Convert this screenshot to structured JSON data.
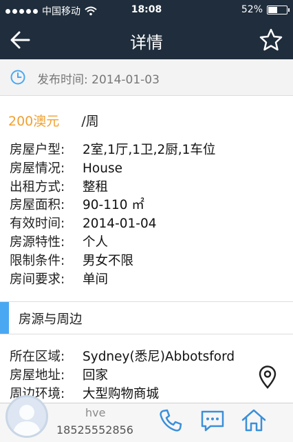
{
  "status_bar": {
    "carrier": "中国移动",
    "time": "18:08",
    "battery": "52%",
    "battery_level": 0.52
  },
  "nav": {
    "title": "详情",
    "back_icon": "back-arrow-icon",
    "favorite_icon": "star-icon"
  },
  "publish": {
    "text": "发布时间:  2014-01-03",
    "icon": "clock-icon"
  },
  "price": {
    "amount": "200澳元",
    "unit": "/周"
  },
  "attributes": [
    {
      "label": "房屋户型:",
      "value": "2室,1厅,1卫,2厨,1车位"
    },
    {
      "label": "房屋情况:",
      "value": "House"
    },
    {
      "label": "出租方式:",
      "value": "整租"
    },
    {
      "label": "房屋面积:",
      "value": "90-110 ㎡"
    },
    {
      "label": "有效时间:",
      "value": "2014-01-04"
    },
    {
      "label": "房源特性:",
      "value": "个人"
    },
    {
      "label": "限制条件:",
      "value": "男女不限"
    },
    {
      "label": "房间要求:",
      "value": "单间"
    }
  ],
  "section": {
    "title": "房源与周边",
    "accent": "#4aa8f2"
  },
  "area": [
    {
      "label": "所在区域:",
      "value": "Sydney(悉尼)Abbotsford"
    },
    {
      "label": "房屋地址:",
      "value": "回家"
    },
    {
      "label": "周边环境:",
      "value": "大型购物商城"
    }
  ],
  "contact": {
    "name": "hve",
    "phone": "18525552856",
    "icons": [
      "phone-icon",
      "message-icon",
      "home-icon"
    ]
  },
  "colors": {
    "nav_bg": "#1f2d3c",
    "price": "#f0a030",
    "icon_blue": "#3a8fd9"
  }
}
